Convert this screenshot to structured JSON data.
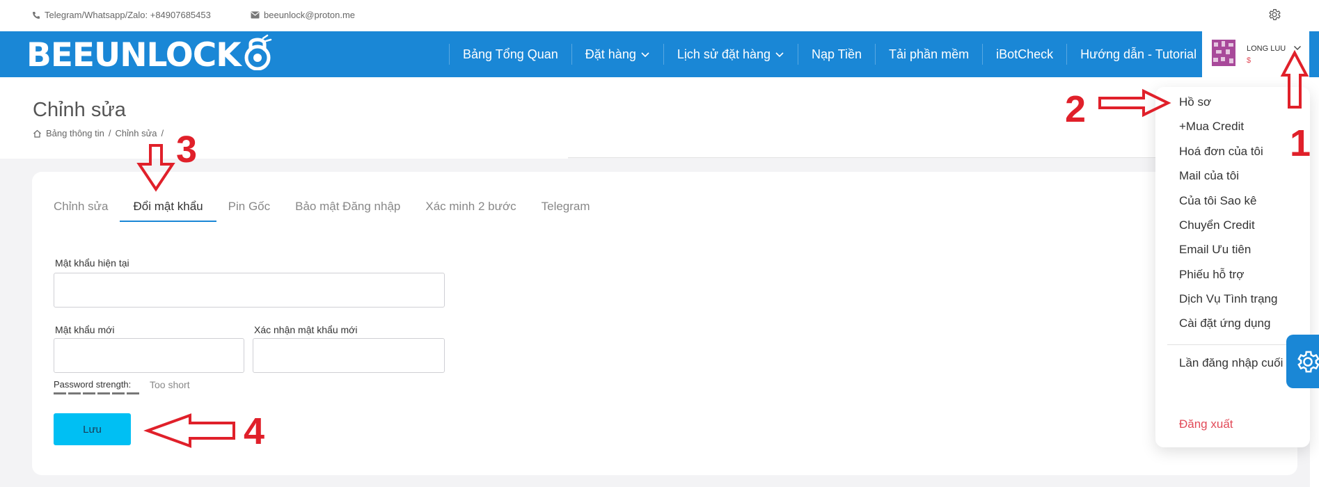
{
  "topbar": {
    "phone": "Telegram/Whatsapp/Zalo: +84907685453",
    "email": "beeunlock@proton.me"
  },
  "brand": {
    "logo": "BEEUNLOCK",
    "primary_color": "#1a87d6",
    "button_color": "#00bff3",
    "alert_color": "#e24a58"
  },
  "nav": {
    "items": [
      {
        "label": "Bảng Tổng Quan",
        "has_chevron": false
      },
      {
        "label": "Đặt hàng",
        "has_chevron": true
      },
      {
        "label": "Lịch sử đặt hàng",
        "has_chevron": true
      },
      {
        "label": "Nạp Tiền",
        "has_chevron": false
      },
      {
        "label": "Tải phần mềm",
        "has_chevron": false
      },
      {
        "label": "iBotCheck",
        "has_chevron": false
      },
      {
        "label": "Hướng dẫn - Tutorial",
        "has_chevron": false
      }
    ],
    "user": {
      "name": "LONG LUU",
      "credit": "$"
    }
  },
  "page": {
    "title": "Chỉnh sửa",
    "breadcrumb": [
      "Bảng thông tin",
      "Chỉnh sửa"
    ]
  },
  "tabs": [
    {
      "label": "Chỉnh sửa",
      "active": false
    },
    {
      "label": "Đổi mật khẩu",
      "active": true
    },
    {
      "label": "Pin Gốc",
      "active": false
    },
    {
      "label": "Bảo mật Đăng nhập",
      "active": false
    },
    {
      "label": "Xác minh 2 bước",
      "active": false
    },
    {
      "label": "Telegram",
      "active": false
    }
  ],
  "form": {
    "current_password_label": "Mật khẩu hiện tại",
    "new_password_label": "Mật khẩu mới",
    "confirm_password_label": "Xác nhận mật khẩu mới",
    "current_password_value": "",
    "new_password_value": "",
    "confirm_password_value": "",
    "strength_label": "Password strength:",
    "strength_value": "Too short",
    "save_label": "Lưu"
  },
  "dropdown": {
    "items": [
      "Hồ sơ",
      "+Mua Credit",
      "Hoá đơn của tôi",
      "Mail của tôi",
      "Của tôi Sao kê",
      "Chuyển Credit",
      "Email Ưu tiên",
      "Phiếu hỗ trợ",
      "Dịch Vụ Tình trạng",
      "Cài đặt ứng dụng"
    ],
    "last_login": "Lần đăng nhập cuối",
    "logout": "Đăng xuất"
  },
  "annotations": {
    "color": "#e0202a",
    "steps": [
      "1",
      "2",
      "3",
      "4"
    ]
  },
  "icons": [
    "phone-icon",
    "envelope-icon",
    "gear-icon",
    "home-icon",
    "chevron-down-icon",
    "lock-icon"
  ]
}
